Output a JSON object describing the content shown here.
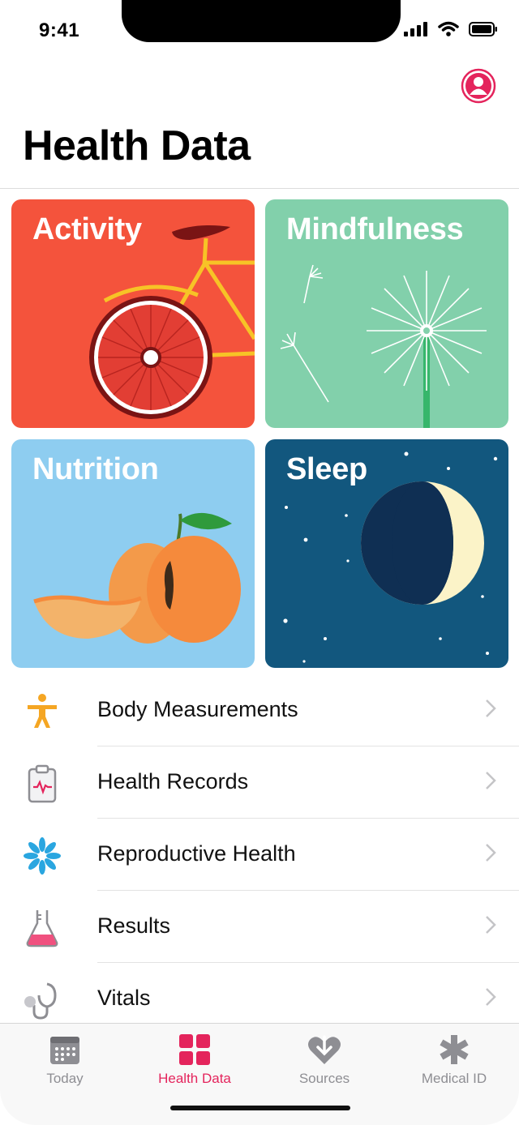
{
  "status_bar": {
    "time": "9:41"
  },
  "header": {
    "title": "Health Data"
  },
  "categories": [
    {
      "label": "Activity",
      "color": "#f4533c"
    },
    {
      "label": "Mindfulness",
      "color": "#82d0ab"
    },
    {
      "label": "Nutrition",
      "color": "#8ecdf0"
    },
    {
      "label": "Sleep",
      "color": "#12577e"
    }
  ],
  "list": [
    {
      "label": "Body Measurements",
      "icon": "body-figure-icon"
    },
    {
      "label": "Health Records",
      "icon": "clipboard-icon"
    },
    {
      "label": "Reproductive Health",
      "icon": "flower-icon"
    },
    {
      "label": "Results",
      "icon": "flask-icon"
    },
    {
      "label": "Vitals",
      "icon": "stethoscope-icon"
    }
  ],
  "tabbar": {
    "tabs": [
      {
        "label": "Today",
        "icon": "calendar-icon",
        "active": false
      },
      {
        "label": "Health Data",
        "icon": "grid-icon",
        "active": true
      },
      {
        "label": "Sources",
        "icon": "heart-arrow-icon",
        "active": false
      },
      {
        "label": "Medical ID",
        "icon": "asterisk-icon",
        "active": false
      }
    ]
  },
  "accent_color": "#e4245c"
}
